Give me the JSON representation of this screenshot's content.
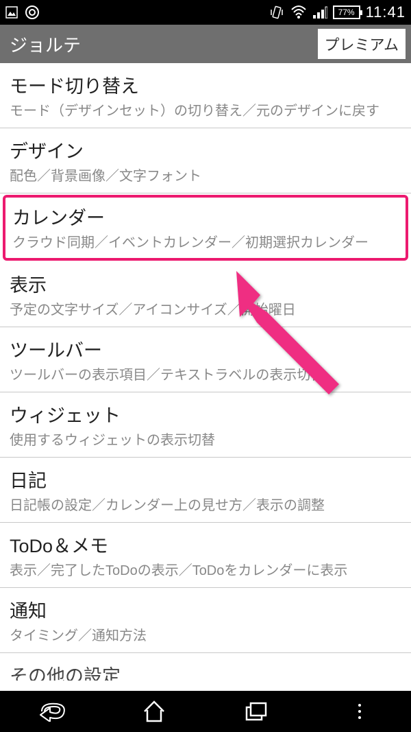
{
  "status": {
    "battery": "77%",
    "time": "11:41"
  },
  "header": {
    "title": "ジョルテ",
    "premium": "プレミアム"
  },
  "settings": [
    {
      "title": "モード切り替え",
      "desc": "モード（デザインセット）の切り替え／元のデザインに戻す",
      "highlighted": false
    },
    {
      "title": "デザイン",
      "desc": "配色／背景画像／文字フォント",
      "highlighted": false
    },
    {
      "title": "カレンダー",
      "desc": "クラウド同期／イベントカレンダー／初期選択カレンダー",
      "highlighted": true
    },
    {
      "title": "表示",
      "desc": "予定の文字サイズ／アイコンサイズ／開始曜日",
      "highlighted": false
    },
    {
      "title": "ツールバー",
      "desc": "ツールバーの表示項目／テキストラベルの表示切替",
      "highlighted": false
    },
    {
      "title": "ウィジェット",
      "desc": "使用するウィジェットの表示切替",
      "highlighted": false
    },
    {
      "title": "日記",
      "desc": "日記帳の設定／カレンダー上の見せ方／表示の調整",
      "highlighted": false
    },
    {
      "title": "ToDo＆メモ",
      "desc": "表示／完了したToDoの表示／ToDoをカレンダーに表示",
      "highlighted": false
    },
    {
      "title": "通知",
      "desc": "タイミング／通知方法",
      "highlighted": false
    },
    {
      "title": "その他の設定",
      "desc": "",
      "highlighted": false
    }
  ]
}
